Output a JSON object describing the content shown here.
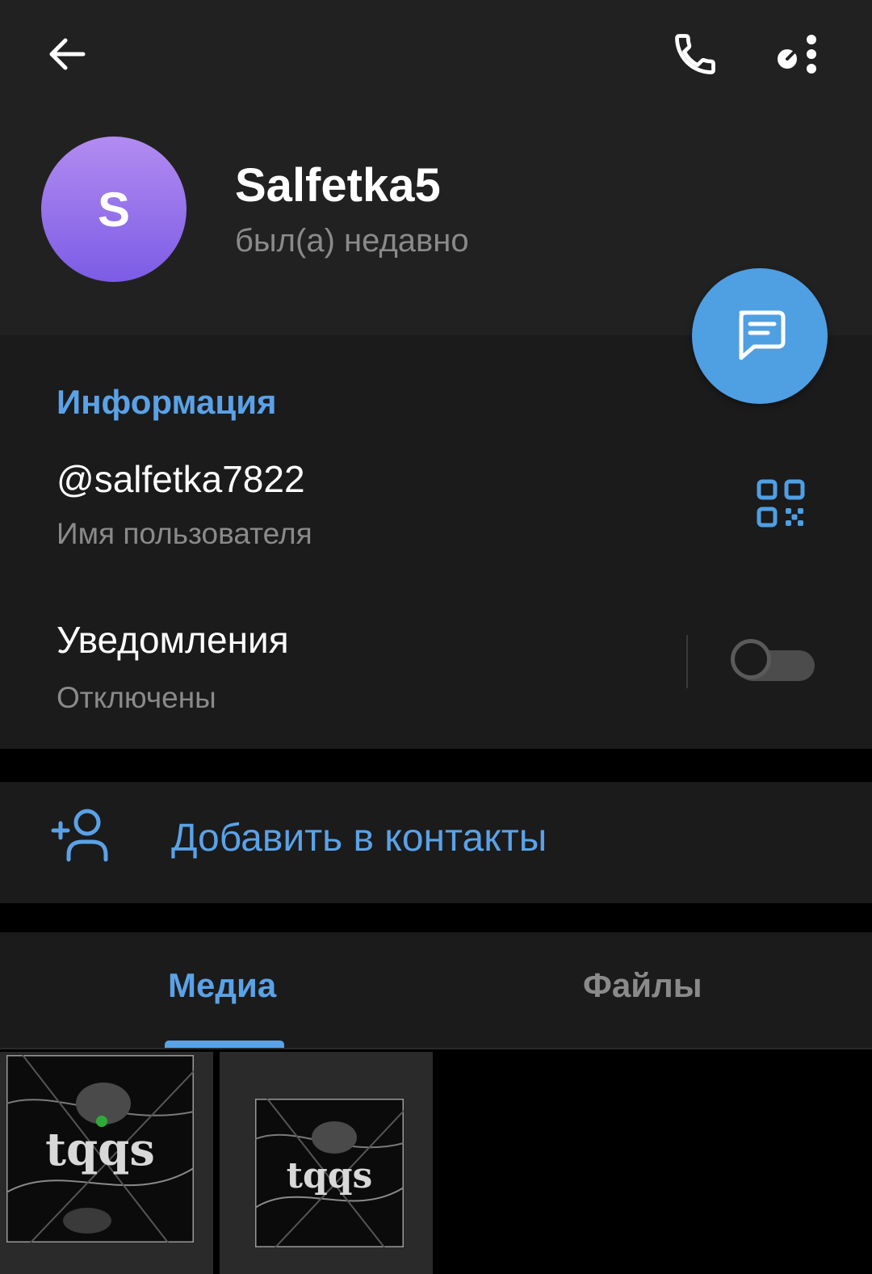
{
  "profile": {
    "avatar_letter": "S",
    "name": "Salfetka5",
    "status": "был(а) недавно"
  },
  "info": {
    "title": "Информация",
    "username": "@salfetka7822",
    "username_label": "Имя пользователя",
    "notifications_title": "Уведомления",
    "notifications_value": "Отключены",
    "notifications_enabled": false
  },
  "actions": {
    "add_contact": "Добавить в контакты"
  },
  "tabs": [
    {
      "label": "Медиа",
      "active": true
    },
    {
      "label": "Файлы",
      "active": false
    }
  ],
  "media": [
    {
      "caption": "tqqs"
    },
    {
      "caption": "tqqs"
    }
  ],
  "icons": {
    "back": "arrow-left-icon",
    "call": "phone-icon",
    "more": "more-vertical-icon",
    "qr": "qr-code-icon",
    "message": "message-icon",
    "add_contact": "add-user-icon"
  },
  "colors": {
    "accent": "#5aa2e8",
    "fab": "#4f9fe3",
    "avatar_top": "#b28cf0",
    "avatar_bottom": "#7c5ce6",
    "header_bg": "#212121",
    "card_bg": "#1b1b1b"
  }
}
